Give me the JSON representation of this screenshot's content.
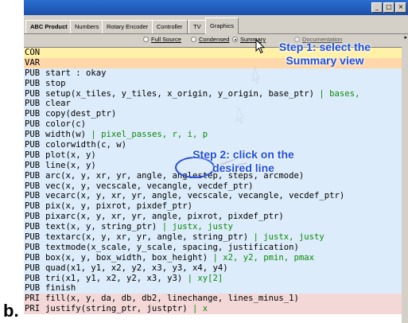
{
  "figure_label": "b.",
  "window": {
    "buttons": {
      "minimize": "_",
      "maximize": "□",
      "close": "×"
    },
    "tabs": [
      "ABC Product",
      "Numbers",
      "Rotary Encoder",
      "Controller",
      "TV",
      "Graphics"
    ],
    "active_tab": "Graphics",
    "view_options": [
      {
        "label": "Full Source",
        "checked": false
      },
      {
        "label": "Condensed",
        "checked": false
      },
      {
        "label": "Summary",
        "checked": true
      },
      {
        "label": "Documentation",
        "checked": false
      }
    ]
  },
  "rows": [
    {
      "kw": "CON",
      "text": "",
      "type": "con"
    },
    {
      "kw": "VAR",
      "text": "",
      "type": "var"
    },
    {
      "kw": "PUB",
      "text": "start : okay",
      "type": "pub"
    },
    {
      "kw": "PUB",
      "text": "stop",
      "type": "pub"
    },
    {
      "kw": "PUB",
      "text": "setup(x_tiles, y_tiles, x_origin, y_origin, base_ptr) ",
      "bar": "| bases,",
      "type": "pub"
    },
    {
      "kw": "PUB",
      "text": "clear",
      "type": "pub"
    },
    {
      "kw": "PUB",
      "text": "copy(dest_ptr)",
      "type": "pub"
    },
    {
      "kw": "PUB",
      "text": "color(c)",
      "type": "pub"
    },
    {
      "kw": "PUB",
      "text": "width(w) ",
      "bar": "| pixel_passes, r, i, p",
      "type": "pub"
    },
    {
      "kw": "PUB",
      "text": "colorwidth(c, w)",
      "type": "pub"
    },
    {
      "kw": "PUB",
      "text": "plot(x, y)",
      "type": "pub"
    },
    {
      "kw": "PUB",
      "text": "line(x, y)",
      "type": "pub"
    },
    {
      "kw": "PUB",
      "text": "arc(x, y, xr, yr, angle, anglestep, steps, arcmode)",
      "type": "pub"
    },
    {
      "kw": "PUB",
      "text": "vec(x, y, vecscale, vecangle, vecdef_ptr)",
      "type": "pub"
    },
    {
      "kw": "PUB",
      "text": "vecarc(x, y, xr, yr, angle, vecscale, vecangle, vecdef_ptr)",
      "type": "pub"
    },
    {
      "kw": "PUB",
      "text": "pix(x, y, pixrot, pixdef_ptr)",
      "type": "pub"
    },
    {
      "kw": "PUB",
      "text": "pixarc(x, y, xr, yr, angle, pixrot, pixdef_ptr)",
      "type": "pub"
    },
    {
      "kw": "PUB",
      "text": "text(x, y, string_ptr) ",
      "bar": "| justx, justy",
      "type": "pub"
    },
    {
      "kw": "PUB",
      "text": "textarc(x, y, xr, yr, angle, string_ptr) ",
      "bar": "| justx, justy",
      "type": "pub"
    },
    {
      "kw": "PUB",
      "text": "textmode(x_scale, y_scale, spacing, justification)",
      "type": "pub"
    },
    {
      "kw": "PUB",
      "text": "box(x, y, box_width, box_height) ",
      "bar": "| x2, y2, pmin, pmax",
      "type": "pub"
    },
    {
      "kw": "PUB",
      "text": "quad(x1, y1, x2, y2, x3, y3, x4, y4)",
      "type": "pub"
    },
    {
      "kw": "PUB",
      "text": "tri(x1, y1, x2, y2, x3, y3) ",
      "bar": "| xy[2]",
      "type": "pub"
    },
    {
      "kw": "PUB",
      "text": "finish",
      "type": "pub"
    },
    {
      "kw": "PRI",
      "text": "fill(x, y, da, db, db2, linechange, lines_minus_1)",
      "type": "pri"
    },
    {
      "kw": "PRI",
      "text": "justify(string_ptr, justptr) ",
      "bar": "| x",
      "type": "pri"
    }
  ],
  "callouts": {
    "step1": "Step 1: select the Summary view",
    "step2": "Step 2: click on the desired line"
  },
  "colors": {
    "con_bg": "#fff1a8",
    "var_bg": "#ffd7a8",
    "pub_bg": "#dcecfa",
    "pri_bg": "#f4d8d8",
    "callout_text": "#1e4fd8",
    "local_var_bar": "#0a8a0a"
  },
  "icons": [
    "cursor-arrow-icon",
    "drag-trail-icon"
  ]
}
